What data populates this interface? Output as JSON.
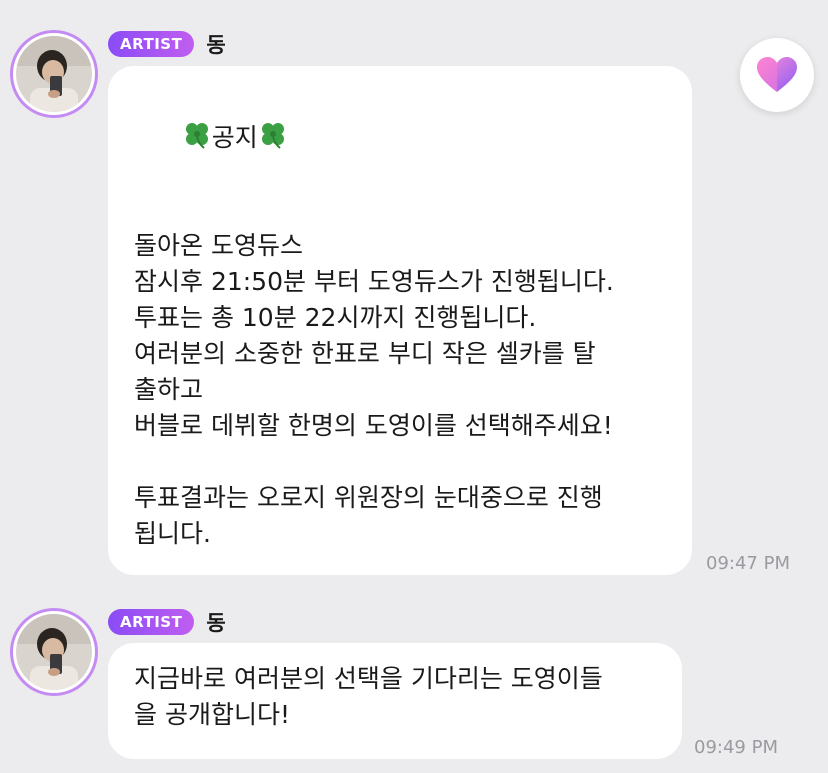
{
  "colors": {
    "background": "#ececee",
    "bubble": "#ffffff",
    "badge_gradient_start": "#8a4cf6",
    "badge_gradient_end": "#c05ef0",
    "avatar_ring": "#c48cf3",
    "timestamp": "#9a9aa0",
    "heart_pink": "#ff7bd1",
    "heart_purple": "#9b6bf6"
  },
  "heart_button": {
    "icon": "heart-icon"
  },
  "messages": [
    {
      "badge": "ARTIST",
      "sender": "동",
      "title_text": "공지",
      "title_icon": "four-leaf-clover-icon",
      "lines": [
        "",
        "돌아온 도영듀스",
        "잠시후 21:50분 부터 도영듀스가 진행됩니다.",
        "투표는 총 10분 22시까지 진행됩니다.",
        "여러분의 소중한 한표로 부디 작은 셀카를 탈",
        "출하고",
        "버블로 데뷔할 한명의 도영이를 선택해주세요!",
        "",
        "투표결과는 오로지 위원장의 눈대중으로 진행",
        "됩니다."
      ],
      "time": "09:47 PM"
    },
    {
      "badge": "ARTIST",
      "sender": "동",
      "lines": [
        "지금바로 여러분의 선택을 기다리는 도영이들",
        "을 공개합니다!"
      ],
      "time": "09:49 PM"
    }
  ]
}
